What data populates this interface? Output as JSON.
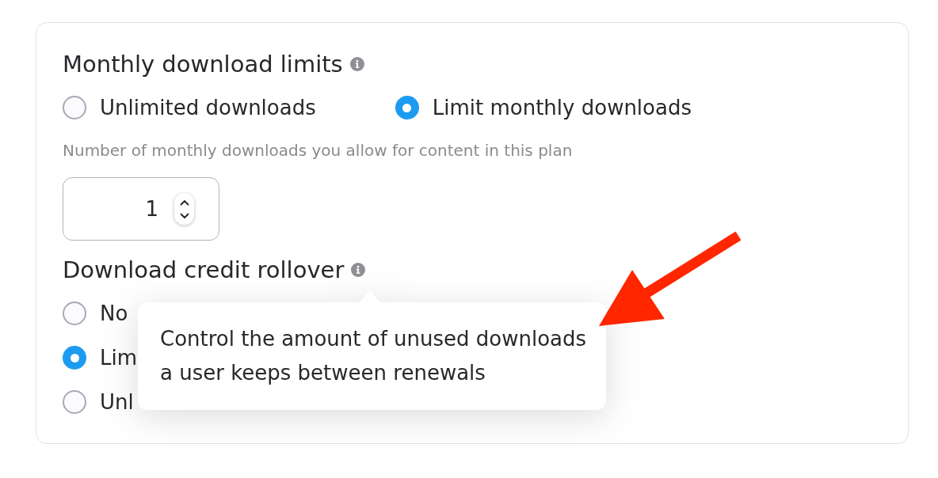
{
  "sections": [
    {
      "kind": "inline",
      "title": "Monthly download limits",
      "options": [
        {
          "label": "Unlimited downloads",
          "selected": false
        },
        {
          "label": "Limit monthly downloads",
          "selected": true
        }
      ],
      "hint": "Number of monthly downloads you allow for content in this plan",
      "number_field": {
        "value": "1"
      }
    },
    {
      "kind": "stacked",
      "title": "Download credit rollover",
      "options": [
        {
          "label": "No",
          "selected": false
        },
        {
          "label": "Lim",
          "selected": true
        },
        {
          "label": "Unl",
          "selected": false
        }
      ],
      "tooltip": {
        "text": "Control the amount of unused downloads a user keeps between renewals"
      }
    }
  ],
  "annotations": [
    {
      "kind": "arrow"
    }
  ]
}
